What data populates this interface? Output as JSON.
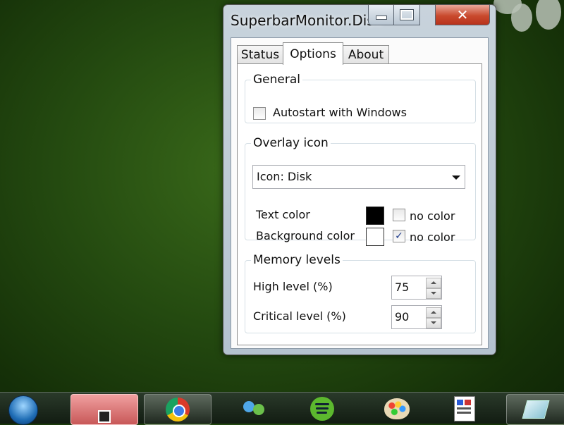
{
  "window": {
    "title": "SuperbarMonitor.Disk",
    "close_glyph": "✕"
  },
  "tabs": [
    {
      "label": "Status"
    },
    {
      "label": "Options"
    },
    {
      "label": "About"
    }
  ],
  "general": {
    "legend": "General",
    "autostart_label": "Autostart with Windows",
    "autostart_checked": false
  },
  "overlay": {
    "legend": "Overlay icon",
    "icon_select": "Icon: Disk",
    "text_color_label": "Text color",
    "text_color_value": "#000000",
    "text_no_color_label": "no color",
    "text_no_color_checked": false,
    "bg_color_label": "Background color",
    "bg_color_value": "#ffffff",
    "bg_no_color_label": "no color",
    "bg_no_color_checked": true,
    "check_glyph": "✓"
  },
  "memory": {
    "legend": "Memory levels",
    "high_label": "High level (%)",
    "high_value": "75",
    "critical_label": "Critical level (%)",
    "critical_value": "90"
  },
  "taskbar": {
    "items": [
      "start-orb-icon",
      "active-app-icon",
      "chrome-icon",
      "messenger-icon",
      "spotify-icon",
      "paint-icon",
      "image-viewer-icon",
      "pinned-app-icon"
    ]
  }
}
